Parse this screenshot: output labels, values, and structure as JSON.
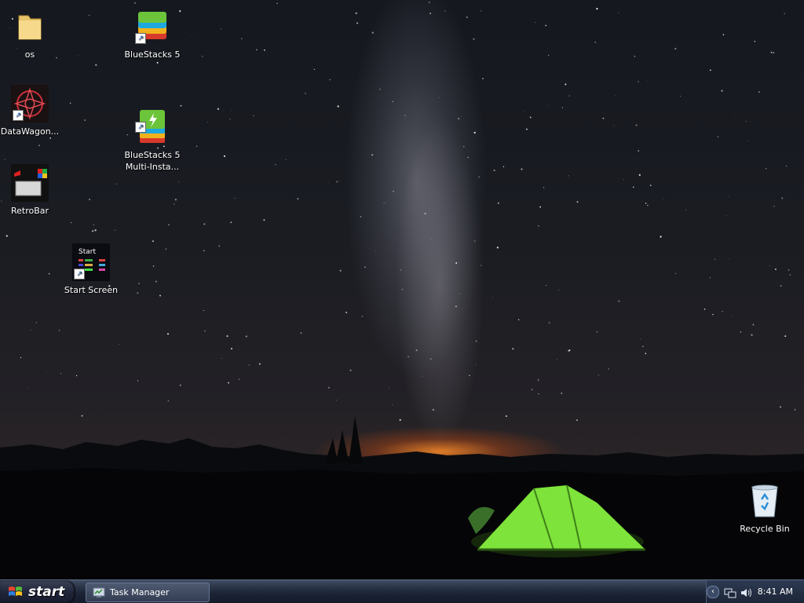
{
  "desktop": {
    "icons": [
      {
        "label": "os"
      },
      {
        "label": "BlueStacks 5"
      },
      {
        "label": "DataWagon..."
      },
      {
        "label": "BlueStacks 5\nMulti-Insta..."
      },
      {
        "label": "RetroBar"
      },
      {
        "label": "Start Screen"
      },
      {
        "label": "Recycle Bin"
      }
    ],
    "start_screen_thumb_text": "Start"
  },
  "taskbar": {
    "start_label": "start",
    "windows": [
      {
        "label": "Task Manager"
      }
    ],
    "clock": "8:41 AM"
  },
  "colors": {
    "taskbar": "#1c2536",
    "tent_green": "#7ee33a",
    "horizon_glow": "#ff8c28"
  },
  "icons_semantic": [
    "folder-icon",
    "bluestacks-icon",
    "datawagon-icon",
    "bluestacks-multi-icon",
    "retrobar-icon",
    "start-screen-icon",
    "recycle-bin-icon",
    "windows-flag-icon",
    "task-manager-icon",
    "chevron-left-icon",
    "network-icon",
    "speaker-icon"
  ]
}
